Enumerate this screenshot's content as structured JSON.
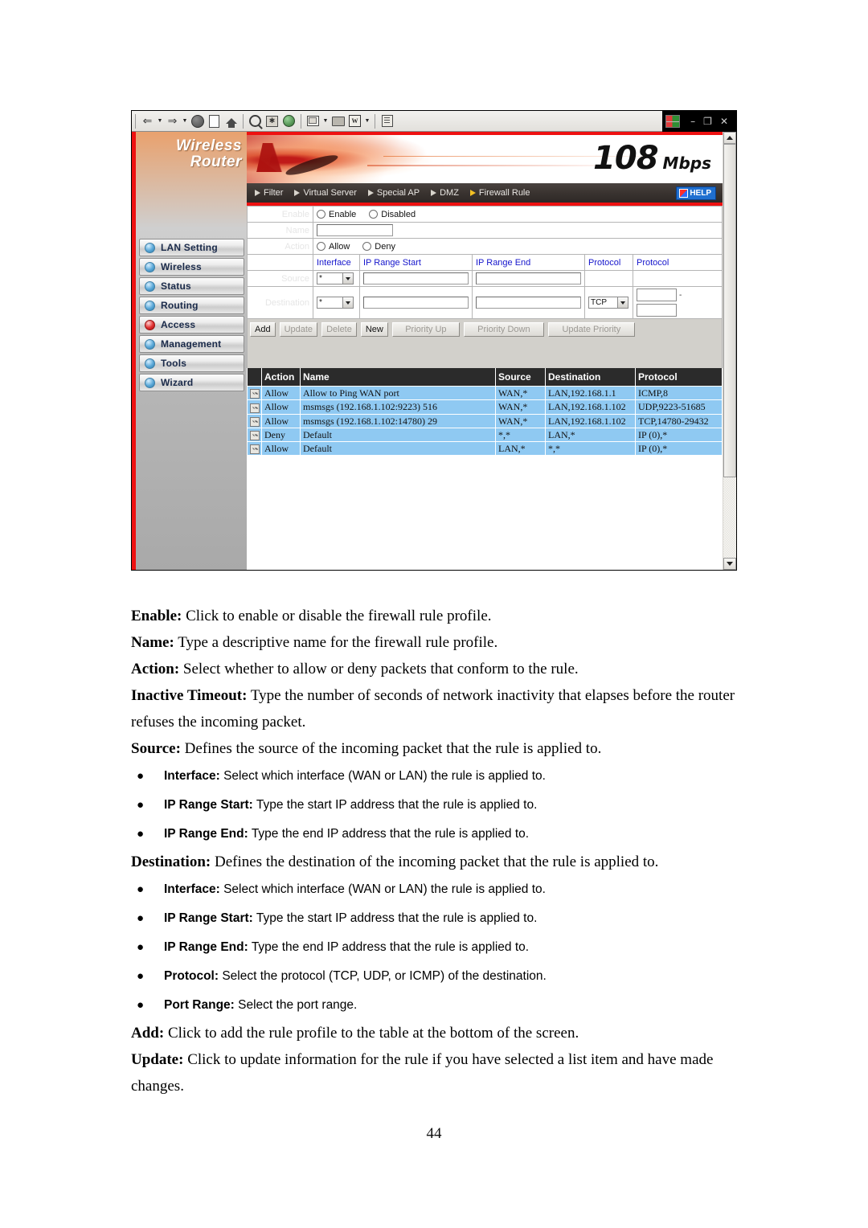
{
  "figure": {
    "browser_toolbar": {
      "icons": [
        "back-icon",
        "back-dropdown-icon",
        "forward-icon",
        "forward-dropdown-icon",
        "stop-icon",
        "refresh-icon",
        "home-icon",
        "search-icon",
        "favorites-icon",
        "history-icon",
        "mail-icon",
        "mail-dropdown-icon",
        "print-icon",
        "edit-word-icon",
        "edit-dropdown-icon",
        "discuss-icon"
      ],
      "word_icon_letter": "W",
      "window_controls": {
        "minimize": "–",
        "restore": "❐",
        "close": "✕"
      }
    },
    "sidebar": {
      "logo_line1": "Wireless",
      "logo_line2": "Router",
      "items": [
        {
          "label": "LAN Setting",
          "bullet": "blue"
        },
        {
          "label": "Wireless",
          "bullet": "blue"
        },
        {
          "label": "Status",
          "bullet": "blue"
        },
        {
          "label": "Routing",
          "bullet": "blue"
        },
        {
          "label": "Access",
          "bullet": "red"
        },
        {
          "label": "Management",
          "bullet": "blue"
        },
        {
          "label": "Tools",
          "bullet": "blue"
        },
        {
          "label": "Wizard",
          "bullet": "blue"
        }
      ]
    },
    "banner": {
      "speed": "108",
      "unit": "Mbps"
    },
    "navbar": {
      "items": [
        {
          "label": "Filter",
          "active": false
        },
        {
          "label": "Virtual Server",
          "active": false
        },
        {
          "label": "Special AP",
          "active": false
        },
        {
          "label": "DMZ",
          "active": false
        },
        {
          "label": "Firewall Rule",
          "active": true
        }
      ],
      "help_label": "HELP"
    },
    "form": {
      "enable_label": "Enable",
      "enable_option1": "Enable",
      "enable_option2": "Disabled",
      "name_label": "Name",
      "name_value": "",
      "action_label": "Action",
      "action_option1": "Allow",
      "action_option2": "Deny",
      "col_interface": "Interface",
      "col_ip_range_start": "IP Range Start",
      "col_ip_range_end": "IP Range End",
      "col_protocol": "Protocol",
      "col_protocol2": "Protocol",
      "source_label": "Source",
      "source_interface": "*",
      "source_ip_start": "",
      "source_ip_end": "",
      "destination_label": "Destination",
      "destination_interface": "*",
      "destination_ip_start": "",
      "destination_ip_end": "",
      "destination_protocol": "TCP",
      "port_start": "",
      "port_end": "",
      "port_dash": "-"
    },
    "buttons": [
      {
        "label": "Add",
        "enabled": true
      },
      {
        "label": "Update",
        "enabled": false
      },
      {
        "label": "Delete",
        "enabled": false
      },
      {
        "label": "New",
        "enabled": true
      },
      {
        "label": "Priority Up",
        "enabled": false
      },
      {
        "label": "Priority Down",
        "enabled": false
      },
      {
        "label": "Update Priority",
        "enabled": false
      }
    ],
    "rules_table": {
      "headers": [
        "",
        "Action",
        "Name",
        "Source",
        "Destination",
        "Protocol"
      ],
      "rows": [
        {
          "checked": true,
          "action": "Allow",
          "name": "Allow to Ping WAN port",
          "source": "WAN,*",
          "destination": "LAN,192.168.1.1",
          "protocol": "ICMP,8"
        },
        {
          "checked": true,
          "action": "Allow",
          "name": "msmsgs (192.168.1.102:9223) 516",
          "source": "WAN,*",
          "destination": "LAN,192.168.1.102",
          "protocol": "UDP,9223-51685"
        },
        {
          "checked": true,
          "action": "Allow",
          "name": "msmsgs (192.168.1.102:14780) 29",
          "source": "WAN,*",
          "destination": "LAN,192.168.1.102",
          "protocol": "TCP,14780-29432"
        },
        {
          "checked": true,
          "action": "Deny",
          "name": "Default",
          "source": "*,*",
          "destination": "LAN,*",
          "protocol": "IP (0),*"
        },
        {
          "checked": true,
          "action": "Allow",
          "name": "Default",
          "source": "LAN,*",
          "destination": "*,*",
          "protocol": "IP (0),*"
        }
      ]
    }
  },
  "prose": {
    "p1_term": "Enable:",
    "p1_text": " Click to enable or disable the firewall rule profile.",
    "p2_term": "Name:",
    "p2_text": " Type a descriptive name for the firewall rule profile.",
    "p3_term": "Action:",
    "p3_text": " Select whether to allow or deny packets that conform to the rule.",
    "p4_term": "Inactive Timeout:",
    "p4_text": " Type the number of seconds of network inactivity that elapses before the router refuses the incoming packet.",
    "p5_term": "Source:",
    "p5_text": " Defines the source of the incoming packet that the rule is applied to.",
    "source_bullets": [
      {
        "term": "Interface:",
        "text": " Select which interface (WAN or LAN) the rule is applied to."
      },
      {
        "term": "IP Range Start:",
        "text": " Type the start IP address that the rule is applied to."
      },
      {
        "term": "IP Range End:",
        "text": " Type the end IP address that the rule is applied to."
      }
    ],
    "p6_term": "Destination:",
    "p6_text": " Defines the destination of the incoming packet that the rule is applied to.",
    "dest_bullets": [
      {
        "term": "Interface:",
        "text": " Select which interface (WAN or LAN) the rule is applied to."
      },
      {
        "term": "IP Range Start:",
        "text": " Type the start IP address that the rule is applied to."
      },
      {
        "term": "IP Range End:",
        "text": " Type the end IP address that the rule is applied to."
      },
      {
        "term": "Protocol:",
        "text": " Select the protocol (TCP, UDP, or ICMP) of the destination."
      },
      {
        "term": "Port Range:",
        "text": " Select the port range."
      }
    ],
    "p7_term": "Add:",
    "p7_text": " Click to add the rule profile to the table at the bottom of the screen.",
    "p8_term": "Update:",
    "p8_text": " Click to update information for the rule if you have selected a list item and have made changes."
  },
  "page_number": "44"
}
